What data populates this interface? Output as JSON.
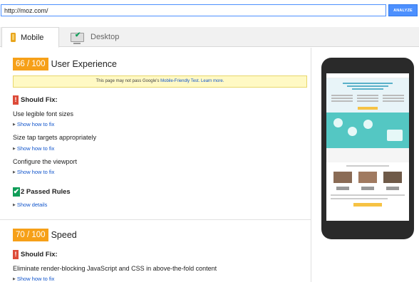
{
  "toolbar": {
    "url_value": "http://moz.com/",
    "analyze_label": "ANALYZE"
  },
  "tabs": [
    {
      "label": "Mobile",
      "icon": "phone-icon",
      "active": true
    },
    {
      "label": "Desktop",
      "icon": "monitor-icon",
      "active": false
    }
  ],
  "ux": {
    "score": "66 / 100",
    "title": "User Experience",
    "notice_text": "This page may not pass Google's",
    "notice_link1": "Mobile-Friendly Test.",
    "notice_link2": "Learn more.",
    "should_fix": "Should Fix:",
    "rules": [
      {
        "title": "Use legible font sizes",
        "link": "Show how to fix"
      },
      {
        "title": "Size tap targets appropriately",
        "link": "Show how to fix"
      },
      {
        "title": "Configure the viewport",
        "link": "Show how to fix"
      }
    ],
    "passed": "2 Passed Rules",
    "passed_link": "Show details"
  },
  "speed": {
    "score": "70 / 100",
    "title": "Speed",
    "should_fix": "Should Fix:",
    "rules": [
      {
        "title": "Eliminate render-blocking JavaScript and CSS in above-the-fold content",
        "link": "Show how to fix"
      }
    ]
  },
  "colors": {
    "score_badge": "#f6a018",
    "link": "#1155cc",
    "warn": "#dd4b39",
    "pass": "#0f9d58",
    "accent": "#4d90fe"
  }
}
